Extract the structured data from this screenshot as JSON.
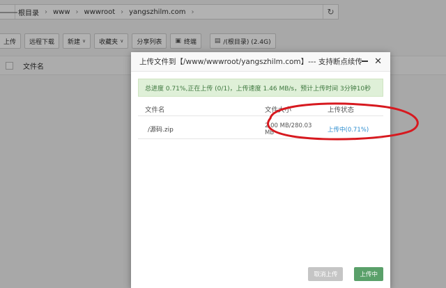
{
  "breadcrumb": {
    "back_icon": "arrow-left-icon",
    "items": [
      "根目录",
      "www",
      "wwwroot",
      "yangszhilm.com"
    ],
    "refresh_icon": "refresh-icon"
  },
  "toolbar": {
    "upload": "上传",
    "remote_download": "远程下载",
    "new": "新建",
    "favorites": "收藏夹",
    "share_list": "分享列表",
    "terminal": "终端",
    "disk": "/(根目录) (2.4G)"
  },
  "file_list": {
    "col_name": "文件名"
  },
  "modal": {
    "title": "上传文件到【/www/wwwroot/yangszhilm.com】--- 支持断点续传",
    "progress_text": "总进度 0.71%,正在上传 (0/1)，上传速度 1.46 MB/s，预计上传时间 3分钟10秒",
    "columns": [
      "文件名",
      "文件大小",
      "上传状态"
    ],
    "rows": [
      {
        "name": "/源码.zip",
        "size": "2.00 MB/280.03 MB",
        "status": "上传中(0.71%)"
      }
    ],
    "cancel_label": "取消上传",
    "uploading_label": "上传中"
  },
  "colors": {
    "progress_bg": "#dff0d8",
    "progress_text": "#3c763d",
    "status_link": "#2b8ccf",
    "annotation": "#d7191f",
    "uploading_btn": "#5aa06a"
  }
}
